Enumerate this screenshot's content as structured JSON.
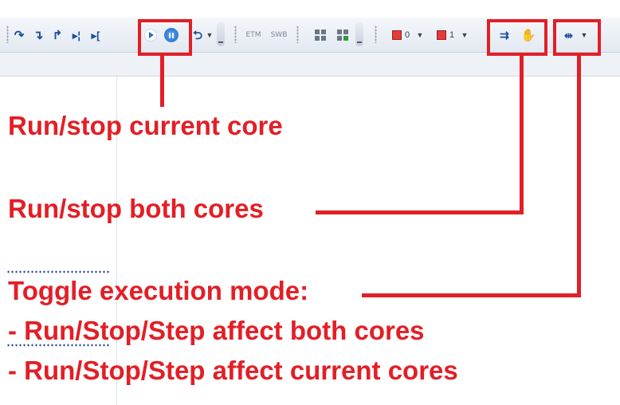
{
  "toolbar": {
    "text_buttons": [
      "ETM",
      "SWB"
    ],
    "counter_values": [
      "0",
      "1"
    ],
    "icons": {
      "step_over": "step-over-icon",
      "step_into": "step-into-icon",
      "step_out": "step-out-icon",
      "run_to_cursor": "run-to-cursor-icon",
      "run_to_line": "run-to-line-icon",
      "run": "play-icon",
      "stop": "pause-icon",
      "reset": "reset-icon",
      "watch_all": "window-grid-icon",
      "watch_add": "window-grid-add-icon",
      "breakpoint_core0": "breakpoint-icon",
      "breakpoint_core1": "breakpoint-icon",
      "run_both": "run-both-icon",
      "stop_both": "stop-hand-icon",
      "exec_mode": "execution-mode-icon"
    },
    "colors": {
      "icon_blue": "#1a4fa0",
      "breakpoint_red": "#e53a3a"
    }
  },
  "annotations": {
    "run_stop_current": "Run/stop current core",
    "run_stop_both": "Run/stop both cores",
    "toggle_mode": "Toggle execution mode:",
    "mode_option_1": "- Run/Stop/Step affect both cores",
    "mode_option_2": "- Run/Stop/Step affect current cores",
    "highlight_color": "#e21f26"
  }
}
